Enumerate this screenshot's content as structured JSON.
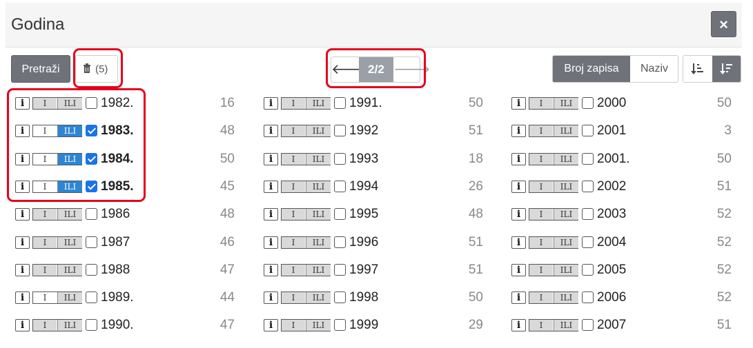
{
  "header": {
    "title": "Godina",
    "close_label": "×"
  },
  "toolbar": {
    "search_label": "Pretraži",
    "clear_icon": "trash-icon",
    "clear_count": "(5)",
    "pager": {
      "prev_icon": "arrow-left-icon",
      "page": "2/2",
      "next_icon": "arrow-right-icon"
    },
    "sort": {
      "by_count": "Broj zapisa",
      "by_name": "Naziv"
    },
    "order": {
      "asc_icon": "sort-asc-icon",
      "desc_icon": "sort-desc-icon"
    }
  },
  "columns": [
    [
      {
        "label": "1982.",
        "count": "16",
        "mode": "gray",
        "checked": false
      },
      {
        "label": "1983.",
        "count": "48",
        "mode": "ili",
        "checked": true
      },
      {
        "label": "1984.",
        "count": "50",
        "mode": "ili",
        "checked": true
      },
      {
        "label": "1985.",
        "count": "45",
        "mode": "ili",
        "checked": true
      },
      {
        "label": "1986",
        "count": "48",
        "mode": "gray",
        "checked": false
      },
      {
        "label": "1987",
        "count": "46",
        "mode": "gray",
        "checked": false
      },
      {
        "label": "1988",
        "count": "47",
        "mode": "gray",
        "checked": false
      },
      {
        "label": "1989.",
        "count": "44",
        "mode": "ili-soft",
        "checked": false
      },
      {
        "label": "1990.",
        "count": "47",
        "mode": "gray",
        "checked": false
      }
    ],
    [
      {
        "label": "1991.",
        "count": "50",
        "mode": "gray",
        "checked": false
      },
      {
        "label": "1992",
        "count": "51",
        "mode": "gray",
        "checked": false
      },
      {
        "label": "1993",
        "count": "18",
        "mode": "gray",
        "checked": false
      },
      {
        "label": "1994",
        "count": "26",
        "mode": "gray",
        "checked": false
      },
      {
        "label": "1995",
        "count": "48",
        "mode": "gray",
        "checked": false
      },
      {
        "label": "1996",
        "count": "51",
        "mode": "gray",
        "checked": false
      },
      {
        "label": "1997",
        "count": "51",
        "mode": "gray",
        "checked": false
      },
      {
        "label": "1998",
        "count": "50",
        "mode": "gray",
        "checked": false
      },
      {
        "label": "1999",
        "count": "29",
        "mode": "gray",
        "checked": false
      }
    ],
    [
      {
        "label": "2000",
        "count": "50",
        "mode": "gray",
        "checked": false
      },
      {
        "label": "2001",
        "count": "3",
        "mode": "gray",
        "checked": false
      },
      {
        "label": "2001.",
        "count": "50",
        "mode": "gray",
        "checked": false
      },
      {
        "label": "2002",
        "count": "51",
        "mode": "gray",
        "checked": false
      },
      {
        "label": "2003",
        "count": "52",
        "mode": "gray",
        "checked": false
      },
      {
        "label": "2004",
        "count": "52",
        "mode": "gray",
        "checked": false
      },
      {
        "label": "2005",
        "count": "52",
        "mode": "gray",
        "checked": false
      },
      {
        "label": "2006",
        "count": "52",
        "mode": "gray",
        "checked": false
      },
      {
        "label": "2007",
        "count": "51",
        "mode": "gray",
        "checked": false
      }
    ]
  ],
  "toggle_labels": {
    "and": "I",
    "or": "ILI"
  },
  "info_label": "i",
  "colors": {
    "accent": "#2d86d3",
    "button_dark": "#6f7379",
    "highlight": "#e3001b"
  }
}
